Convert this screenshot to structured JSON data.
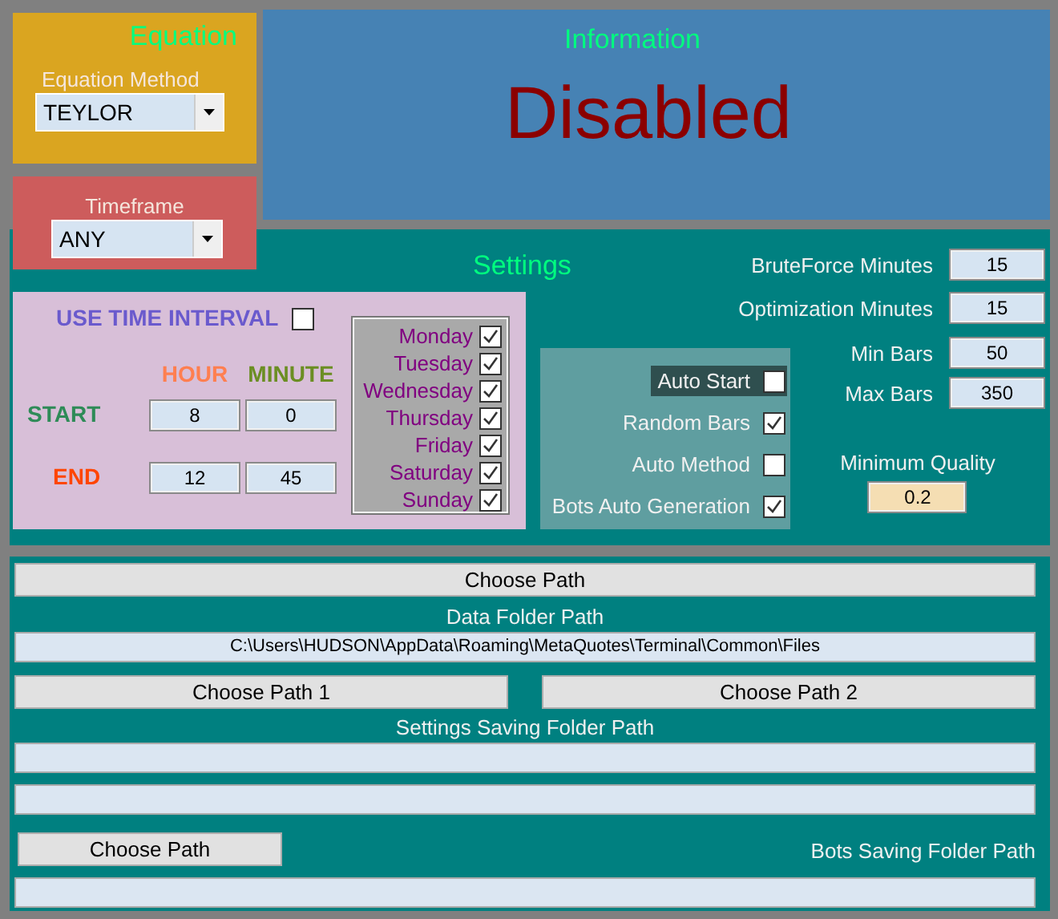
{
  "equation": {
    "title": "Equation",
    "method_label": "Equation Method",
    "method": "TEYLOR"
  },
  "timeframe": {
    "label": "Timeframe",
    "value": "ANY"
  },
  "information": {
    "title": "Information",
    "status": "Disabled"
  },
  "settings": {
    "title": "Settings",
    "time_interval": {
      "label": "USE TIME INTERVAL",
      "checked": false,
      "hour_label": "HOUR",
      "minute_label": "MINUTE",
      "start_label": "START",
      "start_hour": "8",
      "start_minute": "0",
      "end_label": "END",
      "end_hour": "12",
      "end_minute": "45"
    },
    "days": [
      {
        "label": "Monday",
        "checked": true
      },
      {
        "label": "Tuesday",
        "checked": true
      },
      {
        "label": "Wednesday",
        "checked": true
      },
      {
        "label": "Thursday",
        "checked": true
      },
      {
        "label": "Friday",
        "checked": true
      },
      {
        "label": "Saturday",
        "checked": true
      },
      {
        "label": "Sunday",
        "checked": true
      }
    ],
    "options": [
      {
        "label": "Auto Start",
        "checked": false,
        "focused": true
      },
      {
        "label": "Random Bars",
        "checked": true,
        "focused": false
      },
      {
        "label": "Auto Method",
        "checked": false,
        "focused": false
      },
      {
        "label": "Bots Auto Generation",
        "checked": true,
        "focused": false
      }
    ],
    "fields": [
      {
        "label": "BruteForce Minutes",
        "value": "15"
      },
      {
        "label": "Optimization Minutes",
        "value": "15"
      },
      {
        "label": "Min Bars",
        "value": "50"
      },
      {
        "label": "Max Bars",
        "value": "350"
      }
    ],
    "minimum_quality": {
      "label": "Minimum Quality",
      "value": "0.2"
    }
  },
  "paths": {
    "choose_button": "Choose Path",
    "data_label": "Data Folder Path",
    "data_path": "C:\\Users\\HUDSON\\AppData\\Roaming\\MetaQuotes\\Terminal\\Common\\Files",
    "choose_button_1": "Choose Path 1",
    "choose_button_2": "Choose Path 2",
    "settings_label": "Settings Saving Folder Path",
    "bots_button": "Choose Path",
    "bots_label": "Bots Saving Folder Path"
  }
}
